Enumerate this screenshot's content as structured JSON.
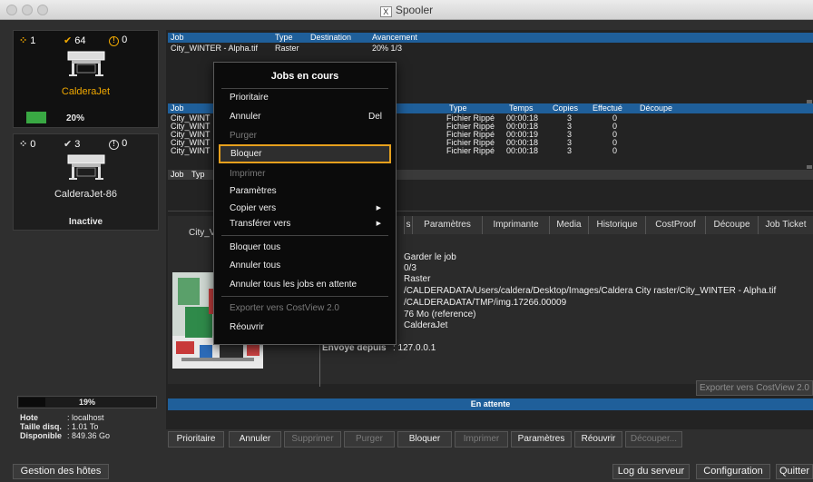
{
  "window": {
    "title": "Spooler",
    "x_badge": "X"
  },
  "printers": [
    {
      "name": "CalderaJet",
      "count_jobs": "1",
      "count_done": "64",
      "count_errors": "0",
      "progress_label": "20%",
      "progress": 0.2,
      "selected": true
    },
    {
      "name": "CalderaJet-86",
      "count_jobs": "0",
      "count_done": "3",
      "count_errors": "0",
      "status": "Inactive"
    }
  ],
  "host": {
    "disk_percent": "19%",
    "disk_fraction": 0.19,
    "rows": [
      {
        "key": "Hote",
        "value": ": localhost"
      },
      {
        "key": "Taille disq.",
        "value": ": 1.01 To"
      },
      {
        "key": "Disponible",
        "value": ": 849.36 Go"
      }
    ]
  },
  "active_table": {
    "headers": [
      "Job",
      "Type",
      "Destination",
      "Avancement"
    ],
    "rows": [
      {
        "job": "City_WINTER - Alpha.tif",
        "type": "Raster",
        "destination": "",
        "progress": "20% 1/3"
      }
    ]
  },
  "history_table": {
    "headers": [
      "Job",
      "Type",
      "Temps",
      "Copies",
      "Effectué",
      "Découpe"
    ],
    "rows": [
      {
        "job": "City_WINT",
        "type": "Fichier Rippé",
        "time": "00:00:18",
        "copies": "3",
        "done": "0"
      },
      {
        "job": "City_WINT",
        "type": "Fichier Rippé",
        "time": "00:00:18",
        "copies": "3",
        "done": "0"
      },
      {
        "job": "City_WINT",
        "type": "Fichier Rippé",
        "time": "00:00:19",
        "copies": "3",
        "done": "0"
      },
      {
        "job": "City_WINT",
        "type": "Fichier Rippé",
        "time": "00:00:18",
        "copies": "3",
        "done": "0"
      },
      {
        "job": "City_WINT",
        "type": "Fichier Rippé",
        "time": "00:00:18",
        "copies": "3",
        "done": "0"
      }
    ]
  },
  "third_table": {
    "headers": [
      "Job",
      "Typ"
    ]
  },
  "tabs": [
    "s",
    "Paramètres",
    "Imprimante",
    "Media",
    "Historique",
    "CostProof",
    "Découpe",
    "Job Ticket"
  ],
  "details": {
    "job_name_truncated": "City_V",
    "values": [
      "Garder le job",
      "0/3",
      "Raster",
      "/CALDERADATA/Users/caldera/Desktop/Images/Caldera City raster/City_WINTER - Alpha.tif",
      "/CALDERADATA/TMP/img.17266.00009",
      "76 Mo (reference)",
      "CalderaJet"
    ],
    "sent_from_label": "Envoyé depuis",
    "sent_from_value": ": 127.0.0.1",
    "export_button": "Exporter vers CostView 2.0"
  },
  "status_bar": "En attente",
  "action_buttons": [
    {
      "label": "Prioritaire",
      "enabled": true
    },
    {
      "label": "Annuler",
      "enabled": true
    },
    {
      "label": "Supprimer",
      "enabled": false
    },
    {
      "label": "Purger",
      "enabled": false
    },
    {
      "label": "Bloquer",
      "enabled": true
    },
    {
      "label": "Imprimer",
      "enabled": false
    },
    {
      "label": "Paramètres",
      "enabled": true
    },
    {
      "label": "Réouvrir",
      "enabled": true
    },
    {
      "label": "Découper...",
      "enabled": false
    }
  ],
  "bottom": {
    "manage_hosts": "Gestion des hôtes",
    "server_log": "Log du serveur",
    "configuration": "Configuration",
    "quit": "Quitter"
  },
  "context_menu": {
    "title": "Jobs en cours",
    "items": [
      {
        "label": "Prioritaire",
        "enabled": true
      },
      {
        "label": "Annuler",
        "shortcut": "Del",
        "enabled": true
      },
      {
        "label": "Purger",
        "enabled": false
      },
      {
        "label": "Bloquer",
        "enabled": true,
        "selected": true
      },
      {
        "label": "Imprimer",
        "enabled": false
      },
      {
        "label": "Paramètres",
        "enabled": true
      },
      {
        "label": "Copier vers",
        "enabled": true,
        "submenu": true
      },
      {
        "label": "Transférer vers",
        "enabled": true,
        "submenu": true
      },
      {
        "label": "Bloquer tous",
        "enabled": true
      },
      {
        "label": "Annuler tous",
        "enabled": true
      },
      {
        "label": "Annuler tous les jobs en attente",
        "enabled": true
      },
      {
        "label": "Exporter vers CostView 2.0",
        "enabled": false
      },
      {
        "label": "Réouvrir",
        "enabled": true
      }
    ]
  },
  "colors": {
    "accent_blue": "#1f5f9a",
    "highlight_orange": "#e6a01d",
    "progress_green": "#39a843",
    "status_orange": "#f0a800"
  }
}
